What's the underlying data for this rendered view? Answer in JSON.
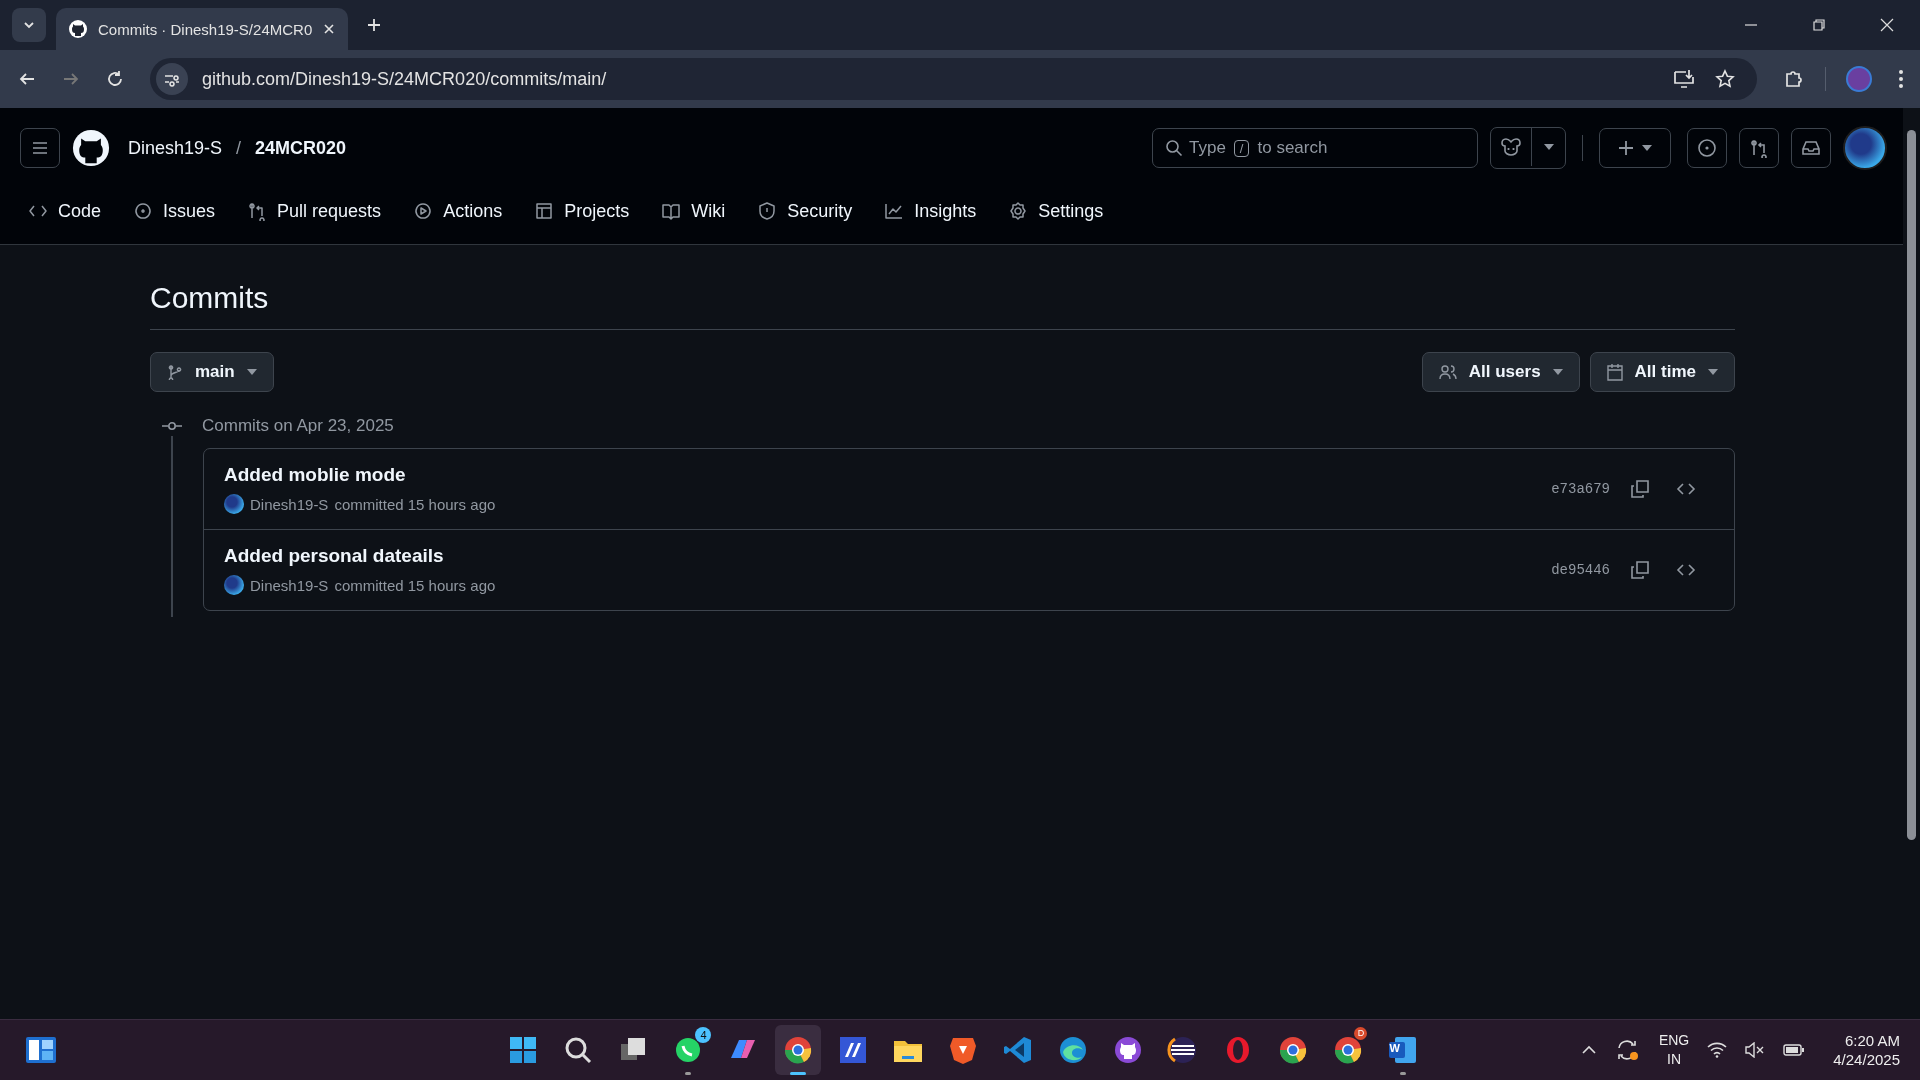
{
  "browser": {
    "tab": {
      "title": "Commits · Dinesh19-S/24MCR0"
    },
    "address": "github.com/Dinesh19-S/24MCR020/commits/main/"
  },
  "header": {
    "owner": "Dinesh19-S",
    "separator": "/",
    "repo": "24MCR020",
    "search": {
      "placeholder_before": "Type",
      "key": "/",
      "placeholder_after": "to search"
    }
  },
  "nav": [
    {
      "label": "Code",
      "kind": "code"
    },
    {
      "label": "Issues",
      "kind": "issues"
    },
    {
      "label": "Pull requests",
      "kind": "pr"
    },
    {
      "label": "Actions",
      "kind": "actions"
    },
    {
      "label": "Projects",
      "kind": "projects"
    },
    {
      "label": "Wiki",
      "kind": "wiki"
    },
    {
      "label": "Security",
      "kind": "security"
    },
    {
      "label": "Insights",
      "kind": "insights"
    },
    {
      "label": "Settings",
      "kind": "settings"
    }
  ],
  "page": {
    "title": "Commits",
    "branch": "main",
    "filters": [
      {
        "label": "All users",
        "kind": "users"
      },
      {
        "label": "All time",
        "kind": "calendar"
      }
    ],
    "groups": [
      {
        "heading": "Commits on Apr 23, 2025",
        "commits": [
          {
            "message": "Added moblie mode",
            "author": "Dinesh19-S",
            "meta": "committed 15 hours ago",
            "sha": "e73a679"
          },
          {
            "message": "Added personal dateails",
            "author": "Dinesh19-S",
            "meta": "committed 15 hours ago",
            "sha": "de95446"
          }
        ]
      }
    ]
  },
  "taskbar": {
    "apps": [
      {
        "kind": "start",
        "running": false,
        "active": false
      },
      {
        "kind": "search",
        "running": false,
        "active": false
      },
      {
        "kind": "taskview",
        "running": false,
        "active": false
      },
      {
        "kind": "chat",
        "badge": "4",
        "running": true,
        "active": false
      },
      {
        "kind": "copilot",
        "running": false,
        "active": false
      },
      {
        "kind": "browser",
        "running": true,
        "active": true
      },
      {
        "kind": "tile",
        "running": false,
        "active": false
      },
      {
        "kind": "folder",
        "running": false,
        "active": false
      },
      {
        "kind": "lion",
        "running": false,
        "active": false
      },
      {
        "kind": "editor",
        "running": false,
        "active": false
      },
      {
        "kind": "wave",
        "running": false,
        "active": false
      },
      {
        "kind": "cat",
        "running": false,
        "active": false
      },
      {
        "kind": "eclipse",
        "running": false,
        "active": false
      },
      {
        "kind": "ring",
        "running": false,
        "active": false
      },
      {
        "kind": "browser",
        "running": false,
        "active": false
      },
      {
        "kind": "browser",
        "badge": "D",
        "running": false,
        "active": false
      },
      {
        "kind": "doc",
        "label": "W",
        "running": true,
        "active": false
      }
    ],
    "language": "ENG",
    "region": "IN",
    "time": "6:20 AM",
    "date": "4/24/2025"
  }
}
